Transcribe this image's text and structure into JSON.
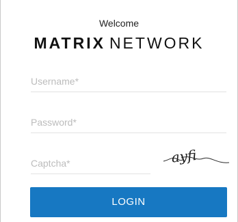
{
  "header": {
    "welcome": "Welcome",
    "brand_bold": "MATRIX",
    "brand_light": "NETWORK"
  },
  "form": {
    "username_placeholder": "Username*",
    "password_placeholder": "Password*",
    "captcha_placeholder": "Captcha*",
    "captcha_text": "ayfi",
    "login_label": "LOGIN"
  },
  "colors": {
    "accent": "#1778c2",
    "placeholder": "#bcbcbc",
    "border": "#c8c8c8"
  },
  "icons": {
    "captcha": "captcha-image-icon"
  }
}
